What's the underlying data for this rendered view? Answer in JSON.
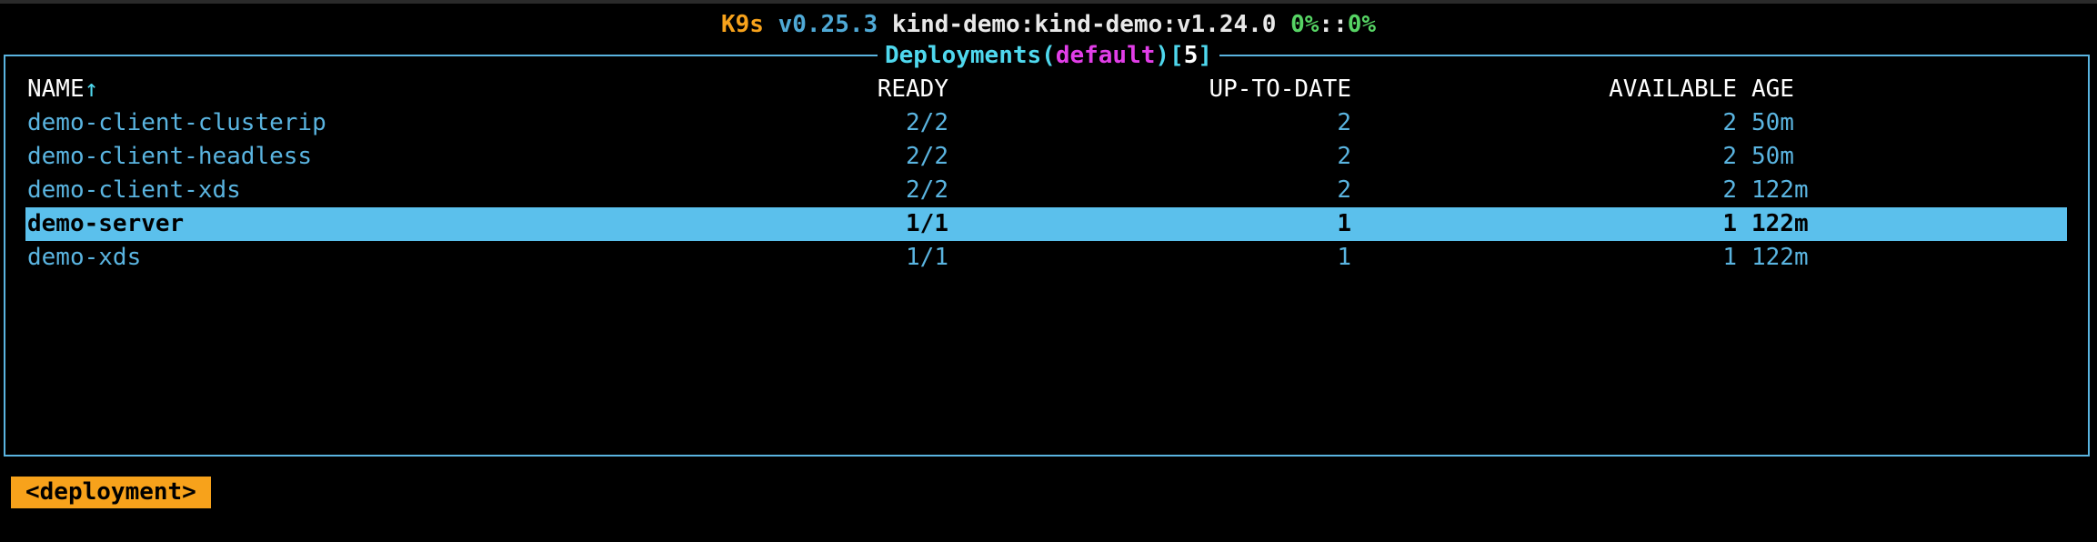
{
  "header": {
    "app": "K9s",
    "version": "v0.25.3",
    "context": "kind-demo:kind-demo:v1.24.0",
    "cpu": "0%",
    "separator": "::",
    "mem": "0%"
  },
  "view": {
    "resource": "Deployments",
    "namespace": "default",
    "count": "5"
  },
  "table": {
    "columns": {
      "name": "NAME",
      "sort_arrow": "↑",
      "ready": "READY",
      "up_to_date": "UP-TO-DATE",
      "available": "AVAILABLE",
      "age": "AGE"
    },
    "rows": [
      {
        "name": "demo-client-clusterip",
        "ready": "2/2",
        "up_to_date": "2",
        "available": "2",
        "age": "50m"
      },
      {
        "name": "demo-client-headless",
        "ready": "2/2",
        "up_to_date": "2",
        "available": "2",
        "age": "50m"
      },
      {
        "name": "demo-client-xds",
        "ready": "2/2",
        "up_to_date": "2",
        "available": "2",
        "age": "122m"
      },
      {
        "name": "demo-server",
        "ready": "1/1",
        "up_to_date": "1",
        "available": "1",
        "age": "122m"
      },
      {
        "name": "demo-xds",
        "ready": "1/1",
        "up_to_date": "1",
        "available": "1",
        "age": "122m"
      }
    ],
    "selected_row": "demo-server"
  },
  "breadcrumb": {
    "label": "<deployment>"
  },
  "colors": {
    "accent_orange": "#f7a21b",
    "border_blue": "#5ab4e0",
    "selection": "#5bc0ec",
    "namespace_magenta": "#e23ee8",
    "percent_green": "#56d364"
  }
}
